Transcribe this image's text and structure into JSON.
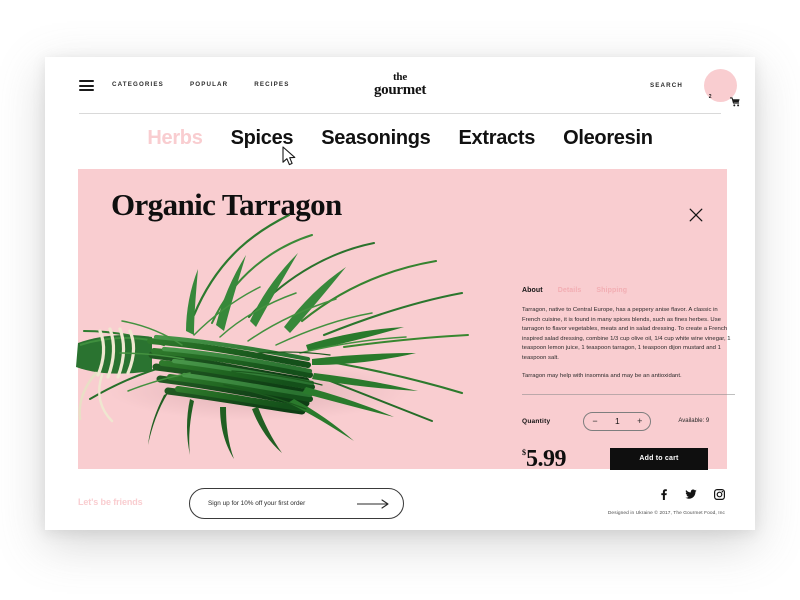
{
  "header": {
    "menu_icon": "hamburger-icon",
    "nav": [
      {
        "label": "CATEGORIES"
      },
      {
        "label": "POPULAR"
      },
      {
        "label": "RECIPES"
      }
    ],
    "brand_line1": "the",
    "brand_line2": "gourmet",
    "search_label": "SEARCH",
    "cart_icon": "shopping-cart-icon",
    "cart_count": "2"
  },
  "categories": [
    {
      "label": "Herbs",
      "active": true
    },
    {
      "label": "Spices",
      "active": false
    },
    {
      "label": "Seasonings",
      "active": false
    },
    {
      "label": "Extracts",
      "active": false
    },
    {
      "label": "Oleoresin",
      "active": false
    }
  ],
  "product": {
    "title": "Organic Tarragon",
    "close_icon": "close-icon",
    "tabs": [
      {
        "label": "About",
        "active": true
      },
      {
        "label": "Details",
        "active": false
      },
      {
        "label": "Shipping",
        "active": false
      }
    ],
    "description": "Tarragon, native to Central Europe, has a peppery anise flavor. A classic in French cuisine, it is found in many spices blends, such as fines herbes. Use tarragon to flavor vegetables, meats and in salad dressing. To create a French inspired salad dressing, combine 1/3 cup olive oil, 1/4 cup white wine vinegar, 1 teaspoon lemon juice, 1 teaspoon tarragon, 1 teaspoon dijon mustard and 1 teaspoon salt.",
    "note": "Tarragon may help with insomnia and may be an antioxidant.",
    "quantity_label": "Quantity",
    "quantity_value": "1",
    "decrement_label": "−",
    "increment_label": "+",
    "availability": "Available: 9",
    "currency_symbol": "$",
    "price": "5.99",
    "add_to_cart_label": "Add to cart"
  },
  "footer": {
    "friends_label": "Let's be friends",
    "signup_placeholder": "Sign up for 10% off your first order",
    "signup_value": "",
    "arrow_icon": "arrow-right-icon",
    "socials": [
      {
        "name": "facebook-icon",
        "glyph": "f"
      },
      {
        "name": "twitter-icon",
        "glyph": "ᵥ"
      },
      {
        "name": "instagram-icon",
        "glyph": "▣"
      }
    ],
    "copyright": "Designed in Ukraine © 2017, The Gourmet Food, Inc"
  },
  "colors": {
    "pink": "#f9cdd0",
    "ink": "#0f0f0f",
    "page": "#ffffff"
  }
}
